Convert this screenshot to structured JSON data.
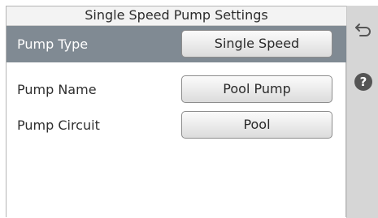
{
  "screen": {
    "title": "Single Speed Pump Settings"
  },
  "rows": [
    {
      "label": "Pump Type",
      "value": "Single Speed",
      "selected": true
    },
    {
      "label": "Pump Name",
      "value": "Pool Pump",
      "selected": false
    },
    {
      "label": "Pump Circuit",
      "value": "Pool",
      "selected": false
    }
  ],
  "sidebar": {
    "back_icon": "back-arrow-icon",
    "help_icon": "help-icon",
    "help_glyph": "?"
  },
  "colors": {
    "selected_row": "#808a93",
    "sidebar": "#d6d6d6",
    "help_circle": "#555555"
  }
}
